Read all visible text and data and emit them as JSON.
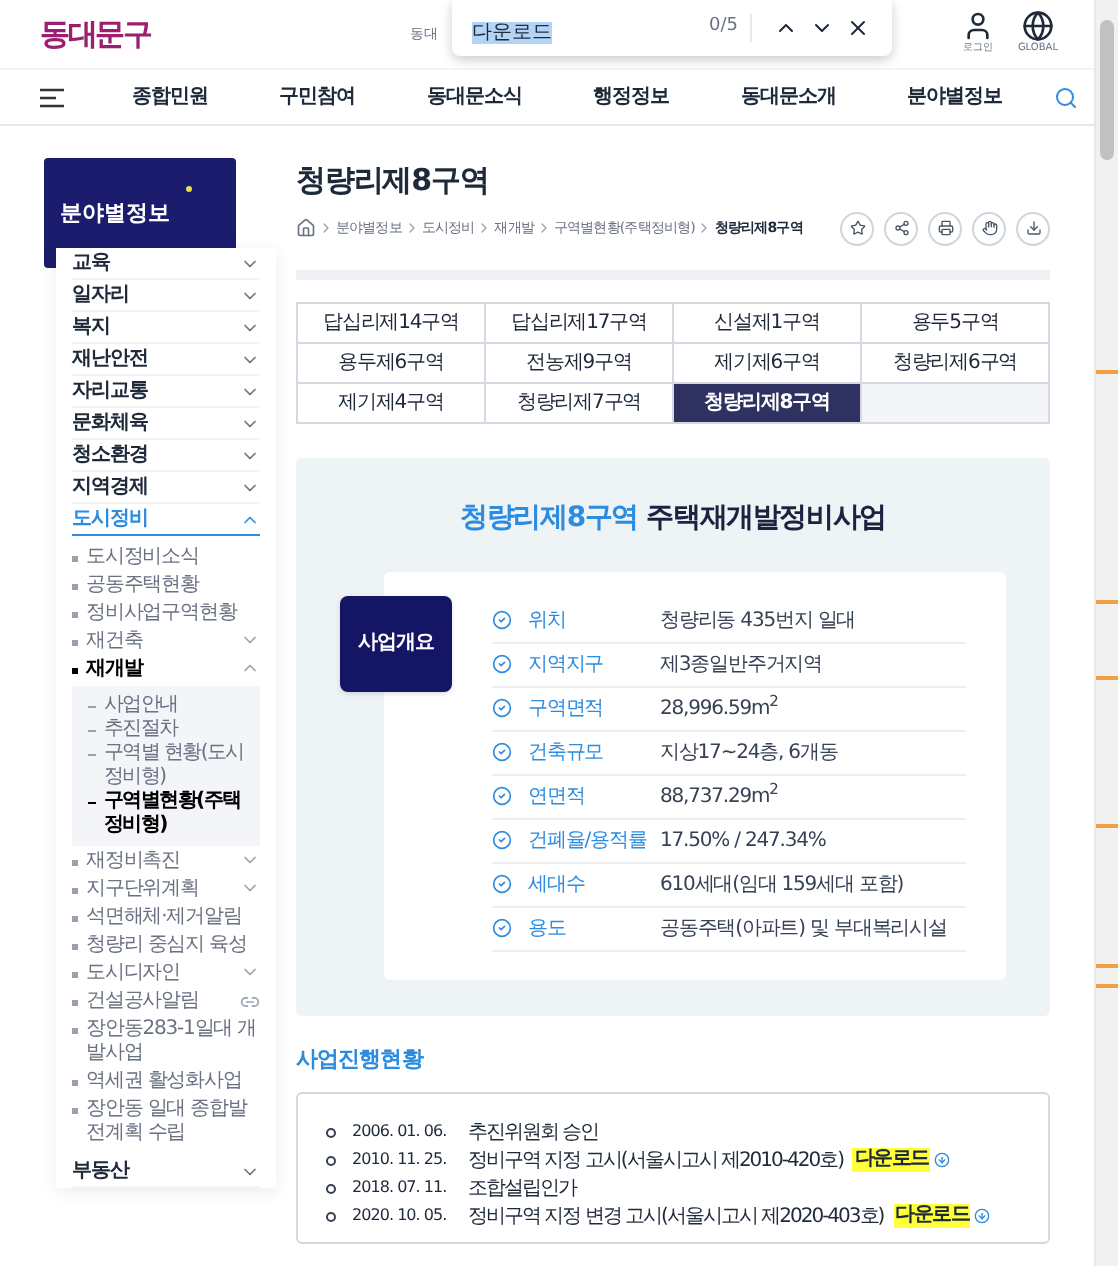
{
  "find_bar": {
    "query": "다운로드",
    "count": "0/5"
  },
  "header": {
    "logo": "동대문구",
    "search_hint": "동대",
    "utilities": [
      {
        "kind": "login",
        "label": "로그인"
      },
      {
        "kind": "global",
        "label": "GLOBAL"
      }
    ]
  },
  "nav": {
    "items": [
      "종합민원",
      "구민참여",
      "동대문소식",
      "행정정보",
      "동대문소개",
      "분야별정보"
    ]
  },
  "sidebar": {
    "title": "분야별정보",
    "items": [
      {
        "label": "교육",
        "expanded": false,
        "selected": false
      },
      {
        "label": "일자리",
        "expanded": false,
        "selected": false
      },
      {
        "label": "복지",
        "expanded": false,
        "selected": false
      },
      {
        "label": "재난안전",
        "expanded": false,
        "selected": false
      },
      {
        "label": "자리교통",
        "expanded": false,
        "selected": false
      },
      {
        "label": "문화체육",
        "expanded": false,
        "selected": false
      },
      {
        "label": "청소환경",
        "expanded": false,
        "selected": false
      },
      {
        "label": "지역경제",
        "expanded": false,
        "selected": false
      },
      {
        "label": "도시정비",
        "expanded": true,
        "selected": true,
        "children": [
          {
            "label": "도시정비소식",
            "selected": false
          },
          {
            "label": "공동주택현황",
            "selected": false
          },
          {
            "label": "정비사업구역현황",
            "selected": false
          },
          {
            "label": "재건축",
            "selected": false,
            "expanded": false
          },
          {
            "label": "재개발",
            "selected": true,
            "expanded": true,
            "children": [
              {
                "label": "사업안내",
                "selected": false
              },
              {
                "label": "추진절차",
                "selected": false
              },
              {
                "label": "구역별 현황(도시정비형)",
                "selected": false
              },
              {
                "label": "구역별현황(주택정비형)",
                "selected": true
              }
            ]
          },
          {
            "label": "재정비촉진",
            "selected": false,
            "expanded": false
          },
          {
            "label": "지구단위계획",
            "selected": false,
            "expanded": false
          },
          {
            "label": "석면해체·제거알림",
            "selected": false
          },
          {
            "label": "청량리 중심지 육성",
            "selected": false
          },
          {
            "label": "도시디자인",
            "selected": false,
            "expanded": false
          },
          {
            "label": "건설공사알림",
            "selected": false,
            "external": true
          },
          {
            "label": "장안동283-1일대 개발사업",
            "selected": false
          },
          {
            "label": "역세권 활성화사업",
            "selected": false
          },
          {
            "label": "장안동 일대 종합발전계획 수립",
            "selected": false
          }
        ]
      },
      {
        "label": "부동산",
        "expanded": false,
        "selected": false
      }
    ]
  },
  "page": {
    "title": "청량리제8구역",
    "breadcrumb": [
      "분야별정보",
      "도시정비",
      "재개발",
      "구역별현황(주택정비형)",
      "청량리제8구역"
    ]
  },
  "tabs": [
    {
      "label": "답십리제14구역",
      "selected": false
    },
    {
      "label": "답십리제17구역",
      "selected": false
    },
    {
      "label": "신설제1구역",
      "selected": false
    },
    {
      "label": "용두5구역",
      "selected": false
    },
    {
      "label": "용두제6구역",
      "selected": false
    },
    {
      "label": "전농제9구역",
      "selected": false
    },
    {
      "label": "제기제6구역",
      "selected": false
    },
    {
      "label": "청량리제6구역",
      "selected": false
    },
    {
      "label": "제기제4구역",
      "selected": false
    },
    {
      "label": "청량리제7구역",
      "selected": false
    },
    {
      "label": "청량리제8구역",
      "selected": true
    }
  ],
  "overview": {
    "title_highlight": "청량리제8구역",
    "title_rest": "주택재개발정비사업",
    "badge": "사업개요",
    "rows": [
      {
        "label": "위치",
        "value": "청량리동 435번지 일대"
      },
      {
        "label": "지역지구",
        "value": "제3종일반주거지역"
      },
      {
        "label": "구역면적",
        "value": "28,996.59m$^{2}$"
      },
      {
        "label": "건축규모",
        "value": "지상17~24층, 6개동"
      },
      {
        "label": "연면적",
        "value": "88,737.29m$^{2}$"
      },
      {
        "label": "건폐율/용적률",
        "value": "17.50% / 247.34%"
      },
      {
        "label": "세대수",
        "value": "610세대(임대 159세대 포함)"
      },
      {
        "label": "용도",
        "value": "공동주택(아파트) 및 부대복리시설"
      }
    ]
  },
  "progress": {
    "title": "사업진행현황",
    "rows": [
      {
        "date": "2006. 01. 06.",
        "text": "추진위원회 승인"
      },
      {
        "date": "2010. 11. 25.",
        "text": "정비구역 지정 고시(서울시고시 제2010-420호)",
        "download": "다운로드"
      },
      {
        "date": "2018. 07. 11.",
        "text": "조합설립인가"
      },
      {
        "date": "2020. 10. 05.",
        "text": "정비구역 지정 변경 고시(서울시고시 제2020-403호)",
        "download": "다운로드"
      }
    ]
  }
}
